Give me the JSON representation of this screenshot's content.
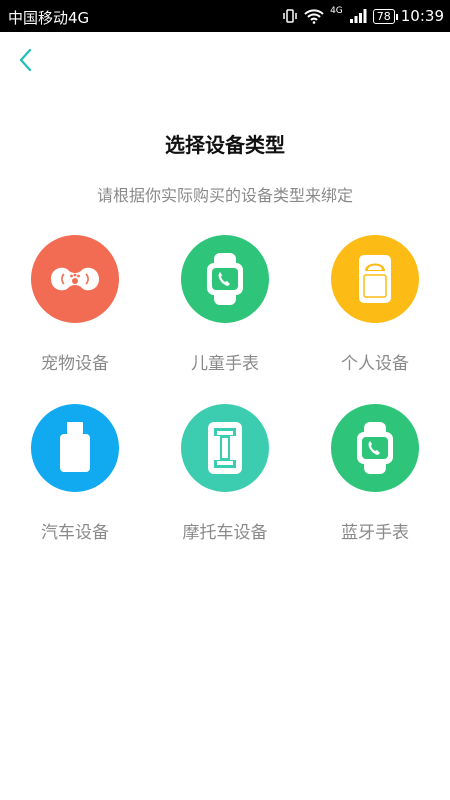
{
  "status_bar": {
    "carrier": "中国移动4G",
    "network": "4G",
    "battery": "78",
    "time": "10:39"
  },
  "colors": {
    "accent": "#1fbfb5",
    "pet": "#f26c53",
    "kids_watch": "#2ec57a",
    "personal": "#fdbb15",
    "car": "#11aaf0",
    "motorcycle": "#3ccdb0",
    "bluetooth_watch": "#2ec57a"
  },
  "page": {
    "title": "选择设备类型",
    "subtitle": "请根据你实际购买的设备类型来绑定"
  },
  "devices": [
    {
      "label": "宠物设备",
      "icon": "pet-tracker-icon"
    },
    {
      "label": "儿童手表",
      "icon": "kids-watch-icon"
    },
    {
      "label": "个人设备",
      "icon": "personal-tracker-icon"
    },
    {
      "label": "汽车设备",
      "icon": "car-obd-icon"
    },
    {
      "label": "摩托车设备",
      "icon": "motorcycle-tracker-icon"
    },
    {
      "label": "蓝牙手表",
      "icon": "bluetooth-watch-icon"
    }
  ]
}
